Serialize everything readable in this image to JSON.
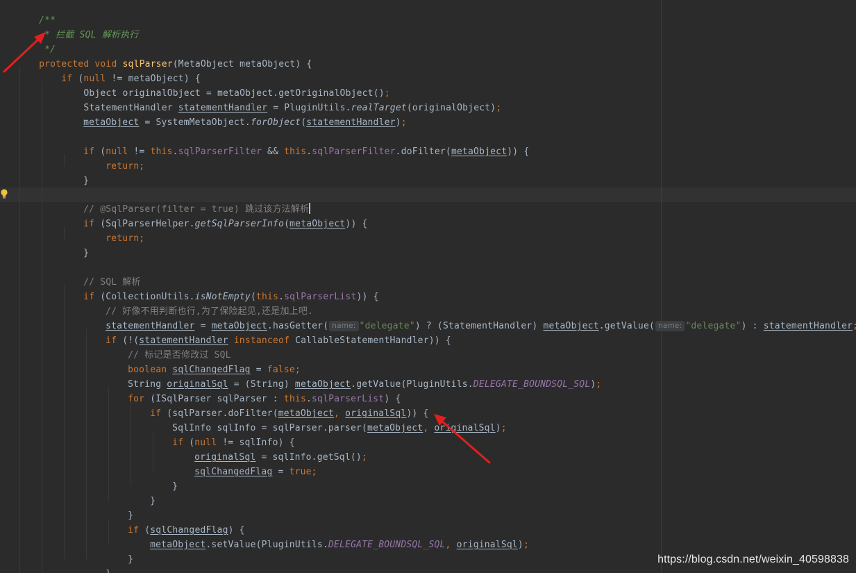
{
  "editor": {
    "lines": {
      "l01": {
        "a": "/**"
      },
      "l02": {
        "a": " * 拦截 SQL 解析执行"
      },
      "l03": {
        "a": " */"
      },
      "l04": {
        "a": "protected void ",
        "b": "sqlParser",
        "c": "(MetaObject metaObject) {"
      },
      "l05": {
        "a": "    ",
        "b": "if ",
        "c": "(",
        "d": "null ",
        "e": "!= metaObject) {"
      },
      "l06": {
        "a": "        Object originalObject = metaObject.getOriginalObject()",
        "b": ";"
      },
      "l07": {
        "a": "        StatementHandler ",
        "b": "statementHandler",
        "c": " = PluginUtils.",
        "d": "realTarget",
        "e": "(originalObject)",
        "f": ";"
      },
      "l08": {
        "a": "metaObject",
        "b": " = SystemMetaObject.",
        "c": "forObject",
        "d": "(",
        "e": "statementHandler",
        "f": ")",
        "g": ";"
      },
      "l10": {
        "a": "if ",
        "b": "(",
        "c": "null ",
        "d": "!= ",
        "e": "this",
        "f": ".",
        "g": "sqlParserFilter",
        "h": " && ",
        "i": "this",
        "j": ".",
        "k": "sqlParserFilter",
        "l": ".doFilter(",
        "m": "metaObject",
        "n": ")) {"
      },
      "l11": {
        "a": "return;"
      },
      "l12": {
        "a": "}"
      },
      "l14": {
        "a": "// @SqlParser(filter = true) 跳过该方法解析"
      },
      "l15": {
        "a": "if ",
        "b": "(SqlParserHelper.",
        "c": "getSqlParserInfo",
        "d": "(",
        "e": "metaObject",
        "f": ")) {"
      },
      "l16": {
        "a": "return;"
      },
      "l17": {
        "a": "}"
      },
      "l19": {
        "a": "// SQL 解析"
      },
      "l20": {
        "a": "if ",
        "b": "(CollectionUtils.",
        "c": "isNotEmpty",
        "d": "(",
        "e": "this",
        "f": ".",
        "g": "sqlParserList",
        "h": ")) {"
      },
      "l21": {
        "a": "// 好像不用判断也行,为了保险起见,还是加上吧."
      },
      "l22": {
        "a": "statementHandler",
        "b": " = ",
        "c": "metaObject",
        "d": ".hasGetter(",
        "hint1": "name:",
        "e": "\"delegate\"",
        "f": ") ? (StatementHandler) ",
        "g": "metaObject",
        "h": ".getValue(",
        "hint2": "name:",
        "i": "\"delegate\"",
        "j": ") : ",
        "k": "statementHandler",
        "l": ";"
      },
      "l23": {
        "a": "if ",
        "b": "(!(",
        "c": "statementHandler",
        "d": " ",
        "e": "instanceof ",
        "f": "CallableStatementHandler)) {"
      },
      "l24": {
        "a": "// 标记是否修改过 SQL"
      },
      "l25": {
        "a": "boolean ",
        "b": "sqlChangedFlag",
        "c": " = ",
        "d": "false;"
      },
      "l26": {
        "a": "String ",
        "b": "originalSql",
        "c": " = (String) ",
        "d": "metaObject",
        "e": ".getValue(PluginUtils.",
        "f": "DELEGATE_BOUNDSQL_SQL",
        "g": ")",
        "h": ";"
      },
      "l27": {
        "a": "for ",
        "b": "(ISqlParser sqlParser : ",
        "c": "this",
        "d": ".",
        "e": "sqlParserList",
        "f": ") {"
      },
      "l28": {
        "a": "if ",
        "b": "(sqlParser.doFilter(",
        "c": "metaObject",
        "d": ", ",
        "e": "originalSql",
        "f": ")) {"
      },
      "l29": {
        "a": "SqlInfo sqlInfo = sqlParser.parser(",
        "b": "metaObject",
        "c": ", ",
        "d": "originalSql",
        "e": ")",
        "f": ";"
      },
      "l30": {
        "a": "if ",
        "b": "(",
        "c": "null ",
        "d": "!= sqlInfo) {"
      },
      "l31": {
        "a": "originalSql",
        "b": " = sqlInfo.getSql()",
        "c": ";"
      },
      "l32": {
        "a": "sqlChangedFlag",
        "b": " = ",
        "c": "true;"
      },
      "l33": {
        "a": "}"
      },
      "l34": {
        "a": "}"
      },
      "l35": {
        "a": "}"
      },
      "l36": {
        "a": "if ",
        "b": "(",
        "c": "sqlChangedFlag",
        "d": ") {"
      },
      "l37": {
        "a": "metaObject",
        "b": ".setValue(PluginUtils.",
        "c": "DELEGATE_BOUNDSQL_SQL",
        "d": ", ",
        "e": "originalSql",
        "f": ")",
        "g": ";"
      },
      "l38": {
        "a": "}"
      },
      "l39": {
        "a": "}"
      },
      "l40": {
        "a": "}"
      }
    }
  },
  "icons": {
    "gutter_icon": "lightbulb-icon",
    "annotation": "red-arrow-icon"
  },
  "colors": {
    "background": "#2b2b2b",
    "keyword": "#cc7832",
    "comment": "#808080",
    "doc_comment": "#629755",
    "method_decl": "#ffc66d",
    "field": "#9876aa",
    "string": "#6a8759",
    "text": "#a9b7c6",
    "arrow": "#e02020"
  },
  "watermark": "https://blog.csdn.net/weixin_40598838"
}
